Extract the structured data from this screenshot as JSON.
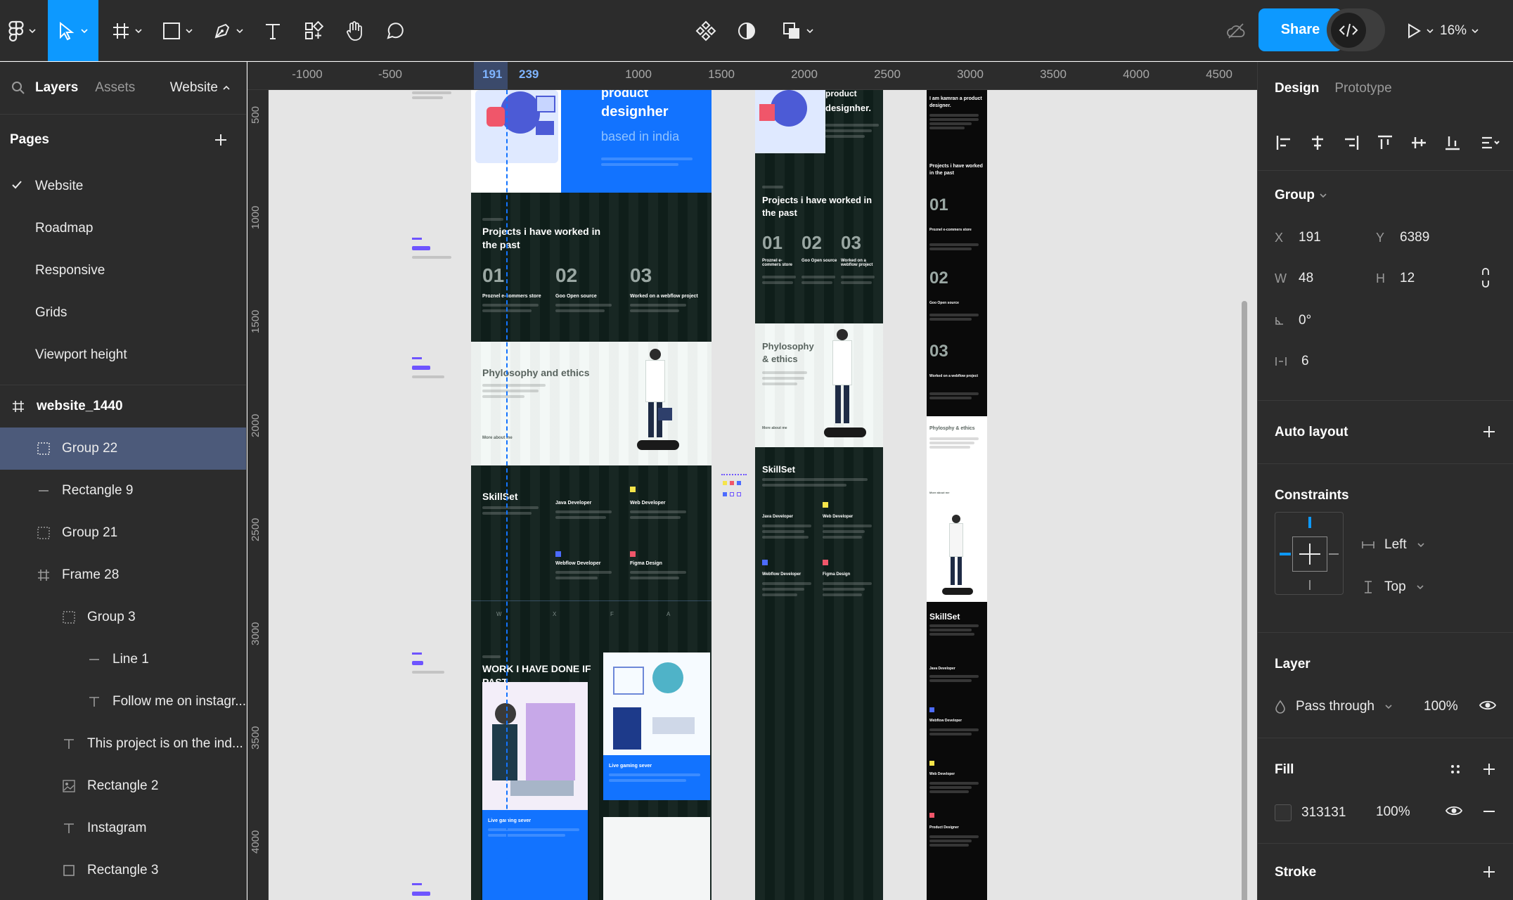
{
  "toolbar": {
    "share_label": "Share",
    "zoom": "16%",
    "tools": [
      "main-menu",
      "move",
      "frame",
      "shape",
      "pen",
      "text",
      "resources",
      "hand",
      "comment"
    ],
    "center_tools": [
      "components",
      "appearance",
      "boolean"
    ],
    "accent": "#0d99ff"
  },
  "left_panel": {
    "tab_layers": "Layers",
    "tab_assets": "Assets",
    "file_name": "Website",
    "pages_title": "Pages",
    "pages": [
      {
        "label": "Website",
        "current": true
      },
      {
        "label": "Roadmap",
        "current": false
      },
      {
        "label": "Responsive",
        "current": false
      },
      {
        "label": "Grids",
        "current": false
      },
      {
        "label": "Viewport height",
        "current": false
      }
    ],
    "layers": [
      {
        "label": "website_1440",
        "icon": "frame-icon",
        "depth": 0,
        "selected": false
      },
      {
        "label": "Group 22",
        "icon": "group-icon",
        "depth": 1,
        "selected": true
      },
      {
        "label": "Rectangle 9",
        "icon": "line-icon",
        "depth": 1,
        "selected": false
      },
      {
        "label": "Group 21",
        "icon": "group-icon",
        "depth": 1,
        "selected": false
      },
      {
        "label": "Frame 28",
        "icon": "frame-icon",
        "depth": 1,
        "selected": false
      },
      {
        "label": "Group 3",
        "icon": "group-icon",
        "depth": 2,
        "selected": false
      },
      {
        "label": "Line 1",
        "icon": "line-icon",
        "depth": 3,
        "selected": false
      },
      {
        "label": "Follow me on instagr...",
        "icon": "text-icon",
        "depth": 3,
        "selected": false
      },
      {
        "label": "This project is on the ind...",
        "icon": "text-icon",
        "depth": 1,
        "selected": false
      },
      {
        "label": "Rectangle 2",
        "icon": "image-icon",
        "depth": 1,
        "selected": false
      },
      {
        "label": "Instagram",
        "icon": "text-icon",
        "depth": 1,
        "selected": false
      },
      {
        "label": "Rectangle 3",
        "icon": "rectangle-icon",
        "depth": 1,
        "selected": false
      }
    ]
  },
  "rulers": {
    "top": [
      "-1000",
      "-500",
      "1000",
      "1500",
      "2000",
      "2500",
      "3000",
      "3500",
      "4000",
      "4500"
    ],
    "selection_start": "191",
    "selection_end": "239",
    "left": [
      "500",
      "1000",
      "1500",
      "2000",
      "2500",
      "3000",
      "3500",
      "4000"
    ]
  },
  "canvas": {
    "frame_a": {
      "hero_title_1": "product",
      "hero_title_2": "designher",
      "hero_title_3": "based in india",
      "projects_title": "Projects i have worked in the past",
      "projects": [
        {
          "num": "01",
          "label": "Proznel e-commers store"
        },
        {
          "num": "02",
          "label": "Goo Open source"
        },
        {
          "num": "03",
          "label": "Worked on a webflow project"
        }
      ],
      "philosophy_title": "Phylosophy and ethics",
      "philosophy_link": "More about me",
      "skillset_title": "SkillSet",
      "skills": [
        "Java Developer",
        "Web Developer",
        "Webflow Developer",
        "Figma Design"
      ],
      "social_icons": [
        "W",
        "X",
        "F",
        "A"
      ],
      "work_title": "WORK I HAVE DONE IF PAST",
      "work_caption_1": "Live gaming sever",
      "work_caption_2": "Live gaming sever"
    },
    "frame_b": {
      "hero_title_1": "product",
      "hero_title_2": "designher.",
      "projects_title": "Projects i have worked in the past",
      "projects": [
        {
          "num": "01",
          "label": "Proznel e-commers store"
        },
        {
          "num": "02",
          "label": "Goo Open source"
        },
        {
          "num": "03",
          "label": "Worked on a webflow project"
        }
      ],
      "philosophy_title": "Phylosophy & ethics",
      "philosophy_link": "More about me",
      "skillset_title": "SkillSet",
      "skills": [
        "Java Developer",
        "Web Developer",
        "Webflow Developer",
        "Figma Design"
      ]
    },
    "frame_c": {
      "intro": "I am kamran a product designer.",
      "projects_title": "Projects i have worked in the past",
      "projects": [
        {
          "num": "01",
          "label": "Proznel e-commers store"
        },
        {
          "num": "02",
          "label": "Goo Open source"
        },
        {
          "num": "03",
          "label": "Worked on a webflow project"
        }
      ],
      "philosophy_title": "Phylosphy & ethics",
      "philosophy_link": "More about me",
      "skillset_title": "SkillSet",
      "skills": [
        "Java Developer",
        "Webflow Developer",
        "Web Developer",
        "Product Designer"
      ]
    }
  },
  "right_panel": {
    "tab_design": "Design",
    "tab_prototype": "Prototype",
    "group_title": "Group",
    "x_label": "X",
    "x_value": "191",
    "y_label": "Y",
    "y_value": "6389",
    "w_label": "W",
    "w_value": "48",
    "h_label": "H",
    "h_value": "12",
    "rotation": "0°",
    "spacing": "6",
    "auto_layout_title": "Auto layout",
    "constraints_title": "Constraints",
    "constraint_h": "Left",
    "constraint_v": "Top",
    "layer_title": "Layer",
    "blend_mode": "Pass through",
    "layer_opacity": "100%",
    "fill_title": "Fill",
    "fill_hex": "313131",
    "fill_opacity": "100%",
    "fill_color": "#313131",
    "stroke_title": "Stroke"
  }
}
